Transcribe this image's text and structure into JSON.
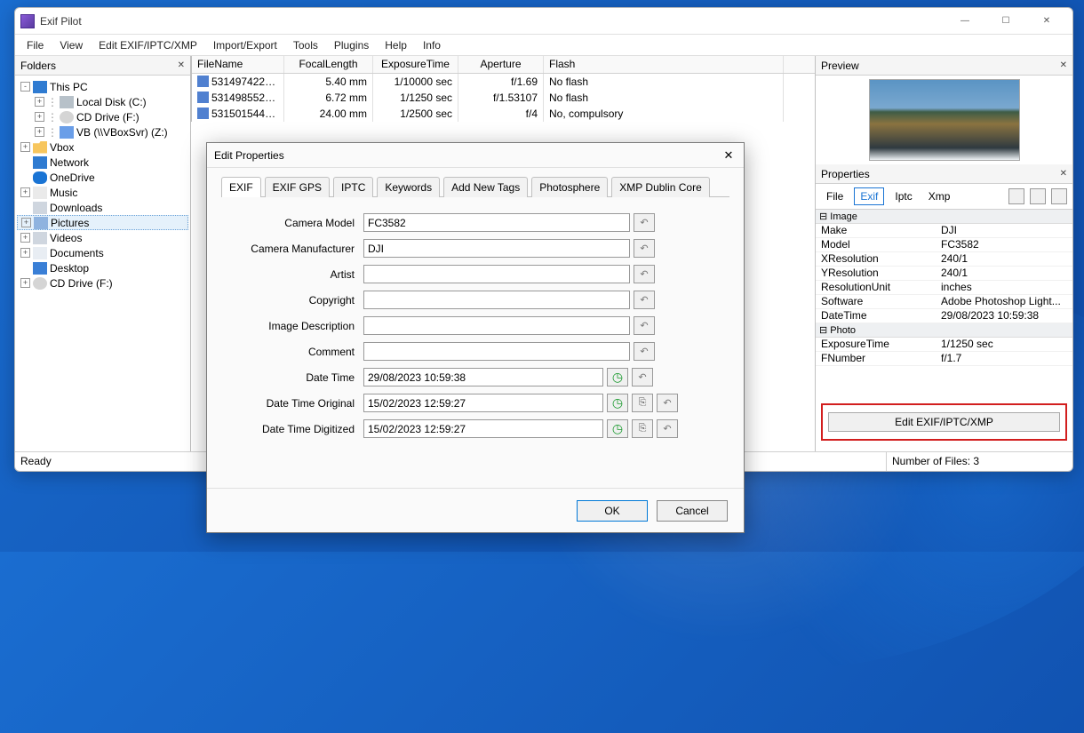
{
  "app": {
    "title": "Exif Pilot"
  },
  "menu": [
    "File",
    "View",
    "Edit EXIF/IPTC/XMP",
    "Import/Export",
    "Tools",
    "Plugins",
    "Help",
    "Info"
  ],
  "folders_panel": {
    "title": "Folders",
    "nodes": [
      {
        "label": "This PC",
        "level": 0,
        "exp": "-",
        "ico": "ico-pc"
      },
      {
        "label": "Local Disk (C:)",
        "level": 1,
        "exp": "+",
        "ico": "ico-disk"
      },
      {
        "label": "CD Drive (F:)",
        "level": 1,
        "exp": "+",
        "ico": "ico-cd"
      },
      {
        "label": "VB (\\\\VBoxSvr) (Z:)",
        "level": 1,
        "exp": "+",
        "ico": "ico-net"
      },
      {
        "label": "Vbox",
        "level": 0,
        "exp": "+",
        "ico": "ico-folder"
      },
      {
        "label": "Network",
        "level": 0,
        "exp": "",
        "ico": "ico-pc"
      },
      {
        "label": "OneDrive",
        "level": 0,
        "exp": "",
        "ico": "ico-cloud"
      },
      {
        "label": "Music",
        "level": 0,
        "exp": "+",
        "ico": "ico-music"
      },
      {
        "label": "Downloads",
        "level": 0,
        "exp": "",
        "ico": "ico-dl"
      },
      {
        "label": "Pictures",
        "level": 0,
        "exp": "+",
        "ico": "ico-pic",
        "selected": true
      },
      {
        "label": "Videos",
        "level": 0,
        "exp": "+",
        "ico": "ico-vid"
      },
      {
        "label": "Documents",
        "level": 0,
        "exp": "+",
        "ico": "ico-doc"
      },
      {
        "label": "Desktop",
        "level": 0,
        "exp": "",
        "ico": "ico-desk"
      },
      {
        "label": "CD Drive (F:)",
        "level": 0,
        "exp": "+",
        "ico": "ico-cd"
      }
    ]
  },
  "file_table": {
    "columns": [
      "FileName",
      "FocalLength",
      "ExposureTime",
      "Aperture",
      "Flash"
    ],
    "rows": [
      {
        "file": "53149742277...",
        "fl": "5.40 mm",
        "et": "1/10000 sec",
        "ap": "f/1.69",
        "flash": "No flash"
      },
      {
        "file": "53149855216...",
        "fl": "6.72 mm",
        "et": "1/1250 sec",
        "ap": "f/1.53107",
        "flash": "No flash"
      },
      {
        "file": "53150154483...",
        "fl": "24.00 mm",
        "et": "1/2500 sec",
        "ap": "f/4",
        "flash": "No, compulsory"
      }
    ]
  },
  "preview": {
    "title": "Preview"
  },
  "properties": {
    "title": "Properties",
    "tabs": [
      "File",
      "Exif",
      "Iptc",
      "Xmp"
    ],
    "active_tab": "Exif",
    "groups": [
      {
        "name": "Image",
        "rows": [
          {
            "k": "Make",
            "v": "DJI"
          },
          {
            "k": "Model",
            "v": "FC3582"
          },
          {
            "k": "XResolution",
            "v": "240/1"
          },
          {
            "k": "YResolution",
            "v": "240/1"
          },
          {
            "k": "ResolutionUnit",
            "v": "inches"
          },
          {
            "k": "Software",
            "v": "Adobe Photoshop Light..."
          },
          {
            "k": "DateTime",
            "v": "29/08/2023 10:59:38"
          }
        ]
      },
      {
        "name": "Photo",
        "rows": [
          {
            "k": "ExposureTime",
            "v": "1/1250 sec"
          },
          {
            "k": "FNumber",
            "v": "f/1.7"
          }
        ]
      }
    ],
    "edit_button": "Edit EXIF/IPTC/XMP"
  },
  "status": {
    "ready": "Ready",
    "files": "Number of Files: 3"
  },
  "dialog": {
    "title": "Edit Properties",
    "tabs": [
      "EXIF",
      "EXIF GPS",
      "IPTC",
      "Keywords",
      "Add New Tags",
      "Photosphere",
      "XMP Dublin Core"
    ],
    "active_tab": "EXIF",
    "fields": {
      "camera_model": {
        "label": "Camera Model",
        "value": "FC3582"
      },
      "camera_make": {
        "label": "Camera Manufacturer",
        "value": "DJI"
      },
      "artist": {
        "label": "Artist",
        "value": ""
      },
      "copyright": {
        "label": "Copyright",
        "value": ""
      },
      "image_desc": {
        "label": "Image Description",
        "value": ""
      },
      "comment": {
        "label": "Comment",
        "value": ""
      },
      "date_time": {
        "label": "Date Time",
        "value": "29/08/2023 10:59:38"
      },
      "date_time_original": {
        "label": "Date Time Original",
        "value": "15/02/2023 12:59:27"
      },
      "date_time_digitized": {
        "label": "Date Time Digitized",
        "value": "15/02/2023 12:59:27"
      }
    },
    "ok": "OK",
    "cancel": "Cancel"
  }
}
